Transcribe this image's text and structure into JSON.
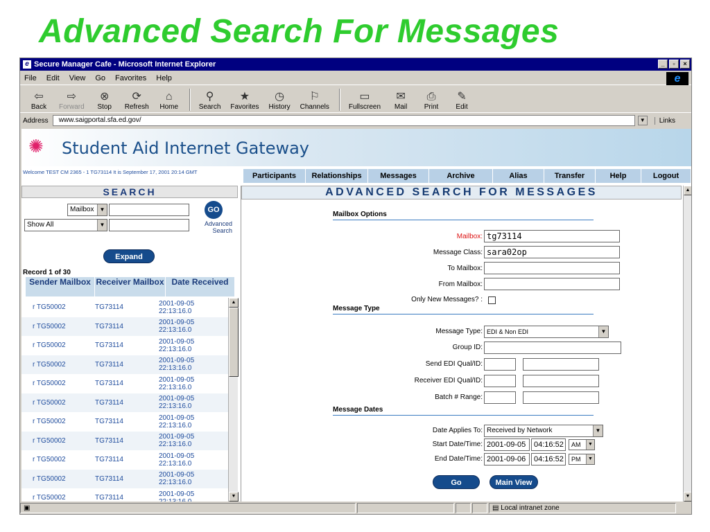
{
  "slide": {
    "title": "Advanced Search For Messages"
  },
  "window": {
    "title": "Secure Manager Cafe - Microsoft Internet Explorer"
  },
  "menu": [
    "File",
    "Edit",
    "View",
    "Go",
    "Favorites",
    "Help"
  ],
  "toolbar": [
    {
      "label": "Back",
      "icon": "back-arrow-icon",
      "glyph": "⇦"
    },
    {
      "label": "Forward",
      "icon": "forward-arrow-icon",
      "glyph": "⇨"
    },
    {
      "label": "Stop",
      "icon": "stop-icon",
      "glyph": "⊗"
    },
    {
      "label": "Refresh",
      "icon": "refresh-icon",
      "glyph": "⟳"
    },
    {
      "label": "Home",
      "icon": "home-icon",
      "glyph": "⌂"
    },
    {
      "label": "Search",
      "icon": "search-icon",
      "glyph": "⚲"
    },
    {
      "label": "Favorites",
      "icon": "favorites-icon",
      "glyph": "★"
    },
    {
      "label": "History",
      "icon": "history-icon",
      "glyph": "◷"
    },
    {
      "label": "Channels",
      "icon": "channels-icon",
      "glyph": "⚐"
    },
    {
      "label": "Fullscreen",
      "icon": "fullscreen-icon",
      "glyph": "▭"
    },
    {
      "label": "Mail",
      "icon": "mail-icon",
      "glyph": "✉"
    },
    {
      "label": "Print",
      "icon": "print-icon",
      "glyph": "⎙"
    },
    {
      "label": "Edit",
      "icon": "edit-icon",
      "glyph": "✎"
    }
  ],
  "address": {
    "label": "Address",
    "url": "www.saigportal.sfa.ed.gov/",
    "links": "Links"
  },
  "site": {
    "brand": "Student Aid Internet Gateway",
    "welcome": "Welcome TEST CM 2365 - 1 TG73114   It is September 17, 2001 20:14 GMT"
  },
  "nav": [
    "Participants",
    "Relationships",
    "Messages",
    "Archive",
    "Alias",
    "Transfer",
    "Help",
    "Logout"
  ],
  "search": {
    "heading": "SEARCH",
    "mailbox_select": "Mailbox",
    "show_select": "Show All",
    "go": "GO",
    "advanced": "Advanced",
    "advanced2": "Search",
    "expand": "Expand",
    "record": "Record 1 of 30",
    "columns": [
      "Sender Mailbox",
      "Receiver Mailbox",
      "Date Received"
    ]
  },
  "rows": [
    {
      "sender": "r TG50002",
      "receiver": "TG73114",
      "date": "2001-09-05",
      "time": "22:13:16.0"
    },
    {
      "sender": "r TG50002",
      "receiver": "TG73114",
      "date": "2001-09-05",
      "time": "22:13:16.0"
    },
    {
      "sender": "r TG50002",
      "receiver": "TG73114",
      "date": "2001-09-05",
      "time": "22:13:16.0"
    },
    {
      "sender": "r TG50002",
      "receiver": "TG73114",
      "date": "2001-09-05",
      "time": "22:13:16.0"
    },
    {
      "sender": "r TG50002",
      "receiver": "TG73114",
      "date": "2001-09-05",
      "time": "22:13:16.0"
    },
    {
      "sender": "r TG50002",
      "receiver": "TG73114",
      "date": "2001-09-05",
      "time": "22:13:16.0"
    },
    {
      "sender": "r TG50002",
      "receiver": "TG73114",
      "date": "2001-09-05",
      "time": "22:13:16.0"
    },
    {
      "sender": "r TG50002",
      "receiver": "TG73114",
      "date": "2001-09-05",
      "time": "22:13:16.0"
    },
    {
      "sender": "r TG50002",
      "receiver": "TG73114",
      "date": "2001-09-05",
      "time": "22:13:16.0"
    },
    {
      "sender": "r TG50002",
      "receiver": "TG73114",
      "date": "2001-09-05",
      "time": "22:13:16.0"
    },
    {
      "sender": "r TG50002",
      "receiver": "TG73114",
      "date": "2001-09-05",
      "time": "22:13:16.0"
    }
  ],
  "form": {
    "heading": "ADVANCED SEARCH FOR MESSAGES",
    "mailbox_options": "Mailbox Options",
    "mailbox_label": "Mailbox:",
    "mailbox_value": "tg73114",
    "class_label": "Message Class:",
    "class_value": "sara02op",
    "to_label": "To Mailbox:",
    "from_label": "From Mailbox:",
    "only_new_label": "Only New Messages? :",
    "message_type_section": "Message Type",
    "type_label": "Message Type:",
    "type_value": "EDI & Non EDI",
    "group_label": "Group ID:",
    "send_label": "Send EDI Qual/ID:",
    "recv_label": "Receiver EDI Qual/ID:",
    "batch_label": "Batch # Range:",
    "dates_section": "Message Dates",
    "applies_label": "Date Applies To:",
    "applies_value": "Received by Network",
    "start_label": "Start Date/Time:",
    "start_date": "2001-09-05",
    "start_time": "04:16:52",
    "start_ampm": "AM",
    "end_label": "End Date/Time:",
    "end_date": "2001-09-06",
    "end_time": "04:16:52",
    "end_ampm": "PM",
    "go": "Go",
    "main_view": "Main View"
  },
  "status": {
    "zone": "Local intranet zone"
  }
}
